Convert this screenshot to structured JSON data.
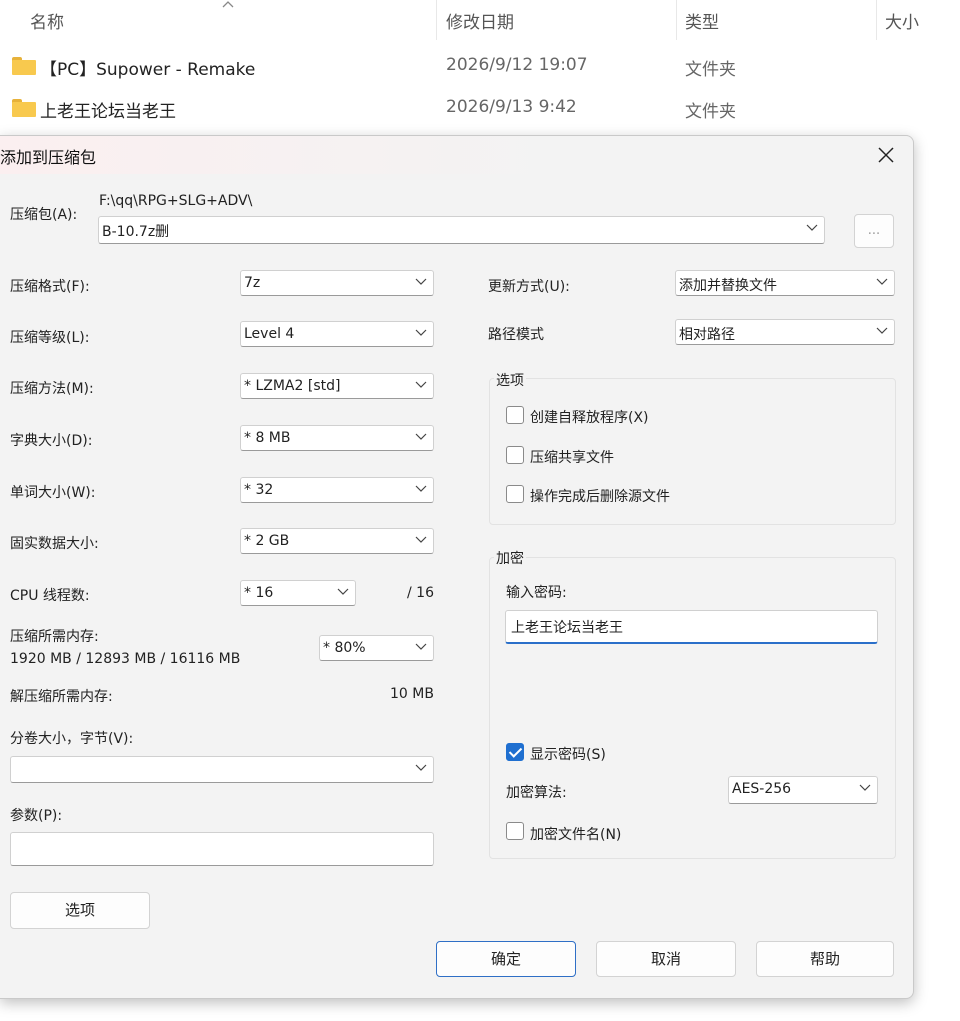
{
  "explorer": {
    "columns": {
      "name": "名称",
      "modified": "修改日期",
      "type": "类型",
      "size": "大小"
    },
    "rows": [
      {
        "name": "【PC】Supower - Remake",
        "modified": "2026/9/12 19:07",
        "type": "文件夹"
      },
      {
        "name": "上老王论坛当老王",
        "modified": "2026/9/13 9:42",
        "type": "文件夹"
      }
    ]
  },
  "dialog": {
    "title": "添加到压缩包",
    "archive_label": "压缩包(A):",
    "archive_path": "F:\\qq\\RPG+SLG+ADV\\",
    "archive_name": "B-10.7z删",
    "browse_label": "...",
    "format_label": "压缩格式(F):",
    "format_value": "7z",
    "level_label": "压缩等级(L):",
    "level_value": "Level 4",
    "method_label": "压缩方法(M):",
    "method_value": "* LZMA2 [std]",
    "dict_label": "字典大小(D):",
    "dict_value": "* 8 MB",
    "word_label": "单词大小(W):",
    "word_value": "* 32",
    "solid_label": "固实数据大小:",
    "solid_value": "* 2 GB",
    "threads_label": "CPU 线程数:",
    "threads_value": "* 16",
    "threads_max": "/ 16",
    "mem_comp_label": "压缩所需内存:",
    "mem_comp_value": "1920 MB / 12893 MB / 16116 MB",
    "mem_percent": "* 80%",
    "mem_decomp_label": "解压缩所需内存:",
    "mem_decomp_value": "10 MB",
    "volume_label": "分卷大小，字节(V):",
    "volume_value": "",
    "params_label": "参数(P):",
    "params_value": "",
    "options_button": "选项",
    "update_label": "更新方式(U):",
    "update_value": "添加并替换文件",
    "path_label": "路径模式",
    "path_value": "相对路径",
    "options_group": "选项",
    "opt_sfx": "创建自释放程序(X)",
    "opt_shared": "压缩共享文件",
    "opt_delete": "操作完成后删除源文件",
    "encryption_group": "加密",
    "password_label": "输入密码:",
    "password_value": "上老王论坛当老王",
    "show_password": "显示密码(S)",
    "enc_method_label": "加密算法:",
    "enc_method_value": "AES-256",
    "encrypt_names": "加密文件名(N)",
    "ok": "确定",
    "cancel": "取消",
    "help": "帮助"
  }
}
